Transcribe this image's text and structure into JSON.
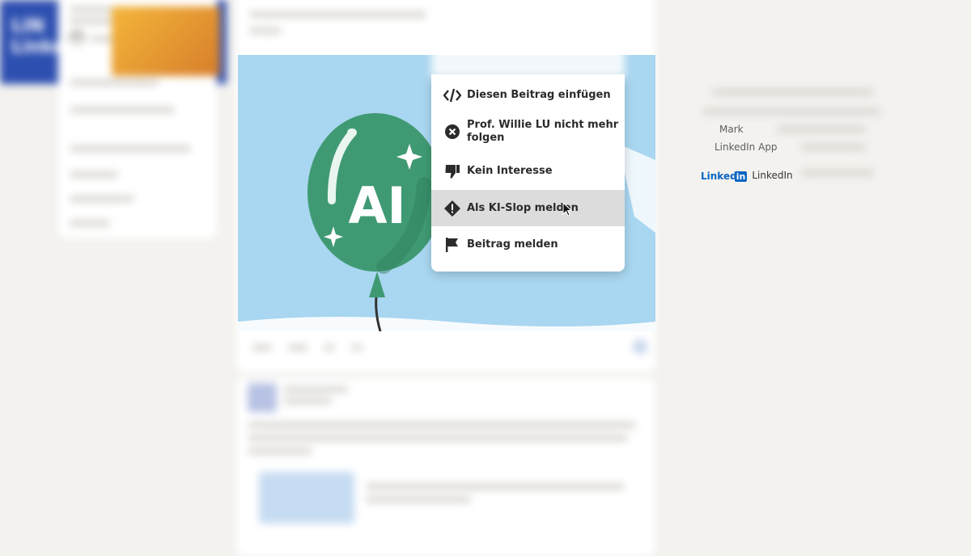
{
  "menu": {
    "items": [
      {
        "label": "Diesen Beitrag einfügen",
        "icon": "code-embed-icon"
      },
      {
        "label": "Prof. Willie LU nicht mehr folgen",
        "icon": "close-circle-icon"
      },
      {
        "label": "Kein Interesse",
        "icon": "thumbs-down-icon"
      },
      {
        "label": "Als KI-Slop melden",
        "icon": "warning-diamond-icon",
        "active": true
      },
      {
        "label": "Beitrag melden",
        "icon": "flag-icon"
      }
    ]
  },
  "post_image": {
    "balloon_text": "AI"
  },
  "right_rail": {
    "footer_fragment_1": "Mark",
    "footer_fragment_2": "LinkedIn App",
    "brand_word": "Linked",
    "brand_in": "in",
    "copyright": "LinkedIn"
  },
  "colors": {
    "balloon": "#3f9a73",
    "sky": "#a9d6f0",
    "brand": "#0a66c2",
    "menu_active": "#dcdcdc"
  }
}
